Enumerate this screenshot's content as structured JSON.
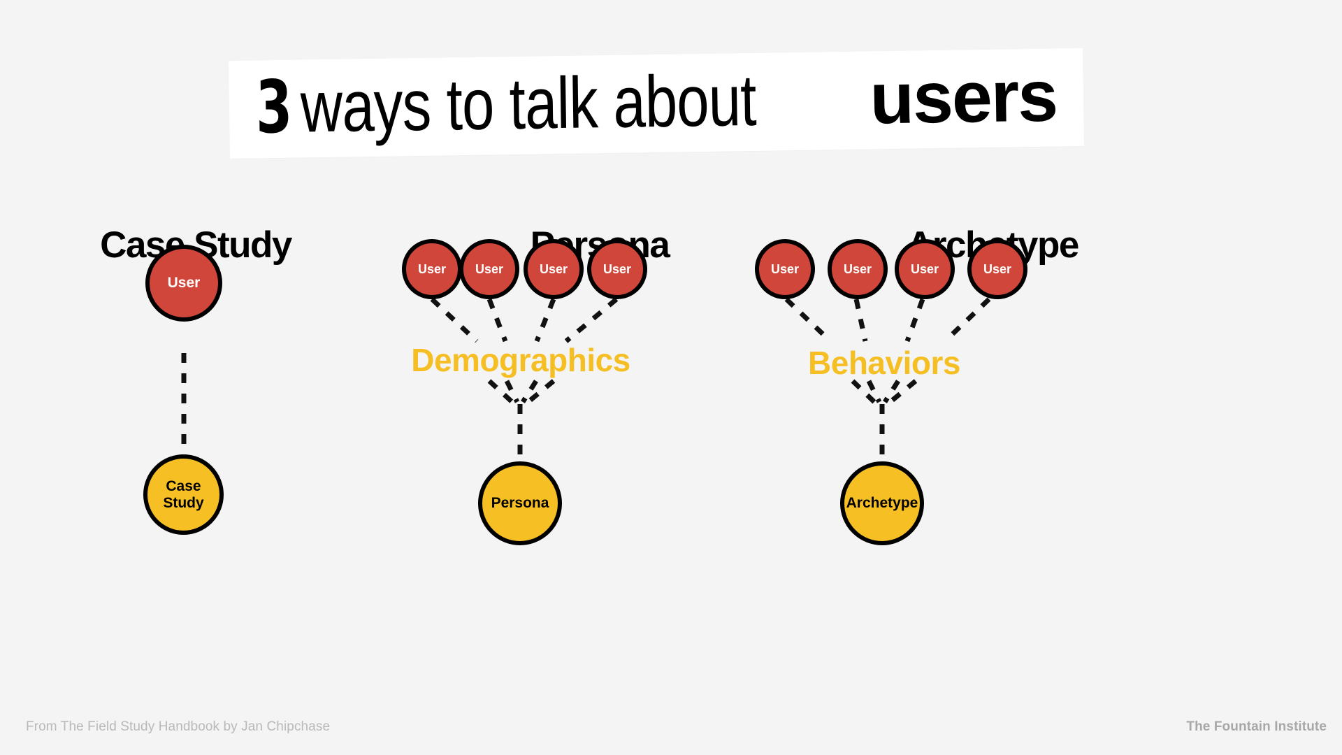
{
  "background_color": "#f4f4f4",
  "palette": {
    "user_node": "#d1463a",
    "output_node": "#f6c024",
    "group_label": "#f5bf24",
    "node_border": "#000000",
    "connector": "#111111",
    "title_band": "#ffffff",
    "footer_text": "#b3b3b3"
  },
  "title": {
    "number": "3",
    "middle": " ways to talk about ",
    "emphasis": "users",
    "full": "3 ways to talk about users"
  },
  "columns": [
    {
      "id": "case-study",
      "heading": "Case Study",
      "user_count": 1,
      "user_labels": [
        "User"
      ],
      "group_label": null,
      "output_label": "Case Study"
    },
    {
      "id": "persona",
      "heading": "Persona",
      "user_count": 4,
      "user_labels": [
        "User",
        "User",
        "User",
        "User"
      ],
      "group_label": "Demographics",
      "output_label": "Persona"
    },
    {
      "id": "archetype",
      "heading": "Archetype",
      "user_count": 4,
      "user_labels": [
        "User",
        "User",
        "User",
        "User"
      ],
      "group_label": "Behaviors",
      "output_label": "Archetype"
    }
  ],
  "footer": {
    "left": "From The Field Study Handbook by Jan Chipchase",
    "right": "The Fountain Institute"
  }
}
